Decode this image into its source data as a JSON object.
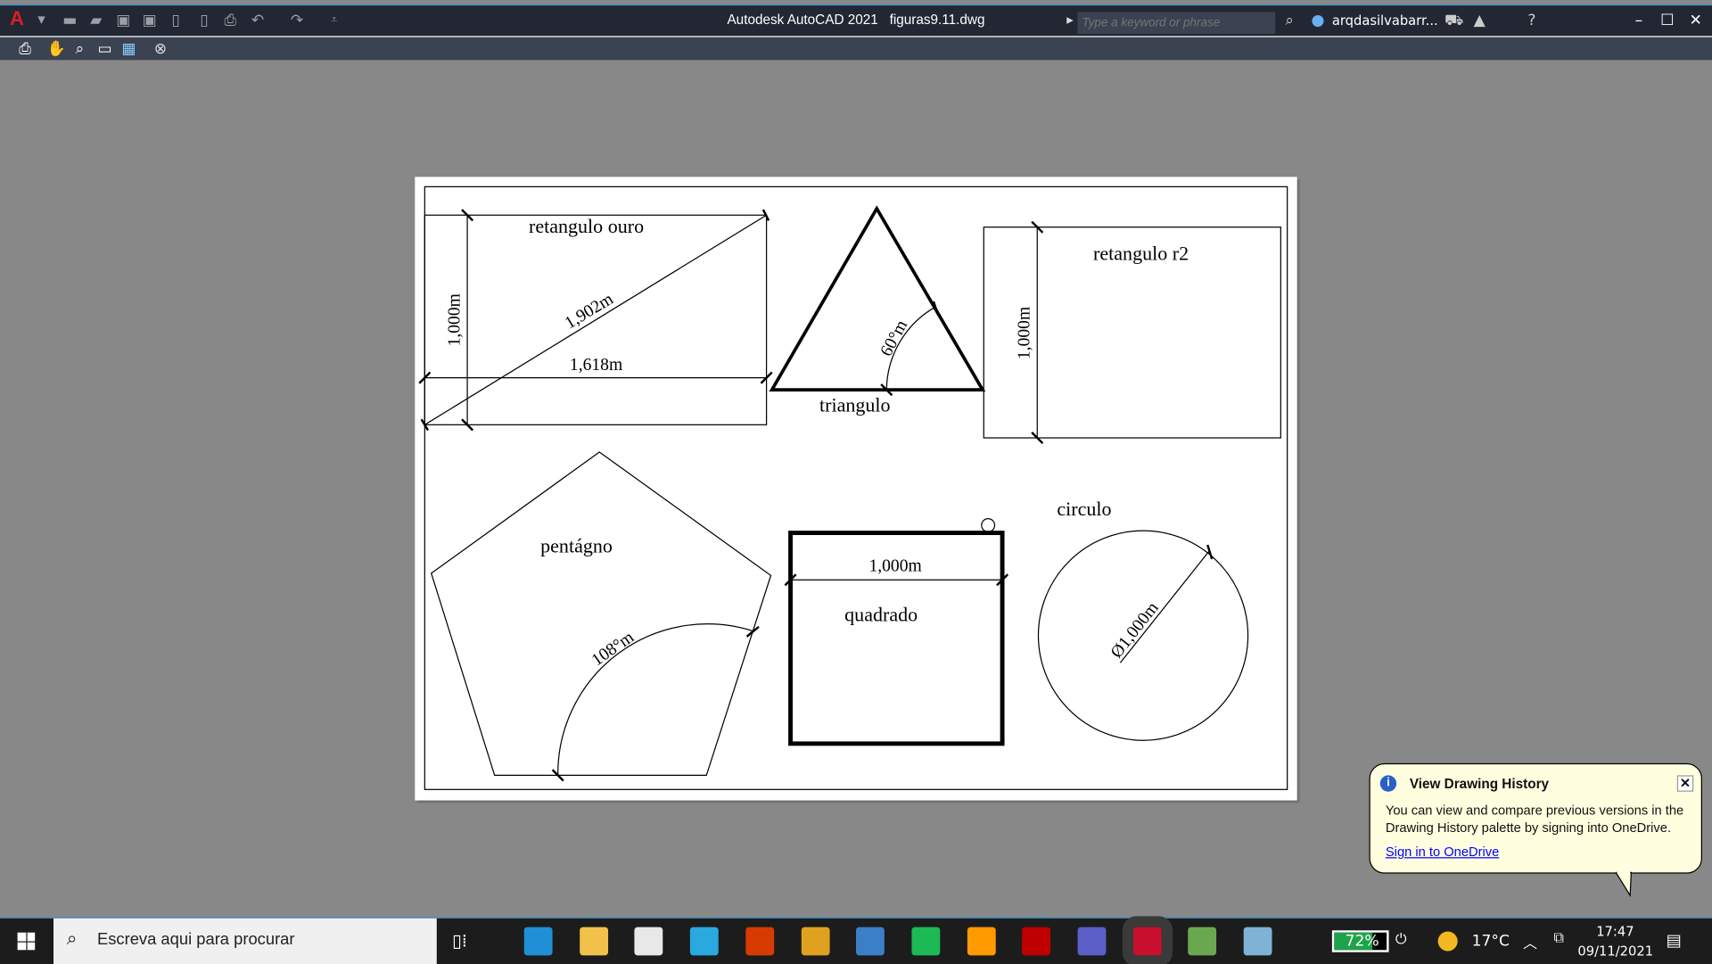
{
  "window": {
    "app_title": "Autodesk AutoCAD 2021",
    "file_name": "figuras9.11.dwg",
    "search_placeholder": "Type a keyword or phrase",
    "user": "arqdasilvabarr..."
  },
  "drawing": {
    "labels": {
      "golden_rect": "retangulo ouro",
      "diagonal": "1,902m",
      "width": "1,618m",
      "height": "1,000m",
      "triangle": "triangulo",
      "angle60": "60°m",
      "rect_r2": "retangulo r2",
      "r2_height": "1,000m",
      "pentagon": "pentágno",
      "angle108": "108°m",
      "square": "quadrado",
      "square_width": "1,000m",
      "circle": "circulo",
      "diameter": "Ø1,000m"
    }
  },
  "balloon": {
    "title": "View Drawing History",
    "body": "You can view and compare previous versions in the Drawing History palette by signing into OneDrive.",
    "link": "Sign in to OneDrive",
    "close": "✕"
  },
  "taskbar": {
    "search_placeholder": "Escreva aqui para procurar",
    "battery": "72%",
    "battery_level": 72,
    "temperature": "17°C",
    "time": "17:47",
    "date": "09/11/2021",
    "apps": [
      {
        "name": "edge",
        "color": "#1f8fd6"
      },
      {
        "name": "file-explorer",
        "color": "#f2c14a"
      },
      {
        "name": "store",
        "color": "#e8e8e8"
      },
      {
        "name": "l-app",
        "color": "#2aa8e0"
      },
      {
        "name": "office",
        "color": "#d83b01"
      },
      {
        "name": "chrome",
        "color": "#e0a020"
      },
      {
        "name": "photos",
        "color": "#3a7fc8"
      },
      {
        "name": "spotify",
        "color": "#1db954"
      },
      {
        "name": "illustrator",
        "color": "#ff9a00"
      },
      {
        "name": "filezilla",
        "color": "#bf0000"
      },
      {
        "name": "teams",
        "color": "#5b5fc7"
      },
      {
        "name": "autocad",
        "color": "#c8102e"
      },
      {
        "name": "maps",
        "color": "#6aa84f"
      },
      {
        "name": "app",
        "color": "#7fb3d5"
      }
    ]
  }
}
